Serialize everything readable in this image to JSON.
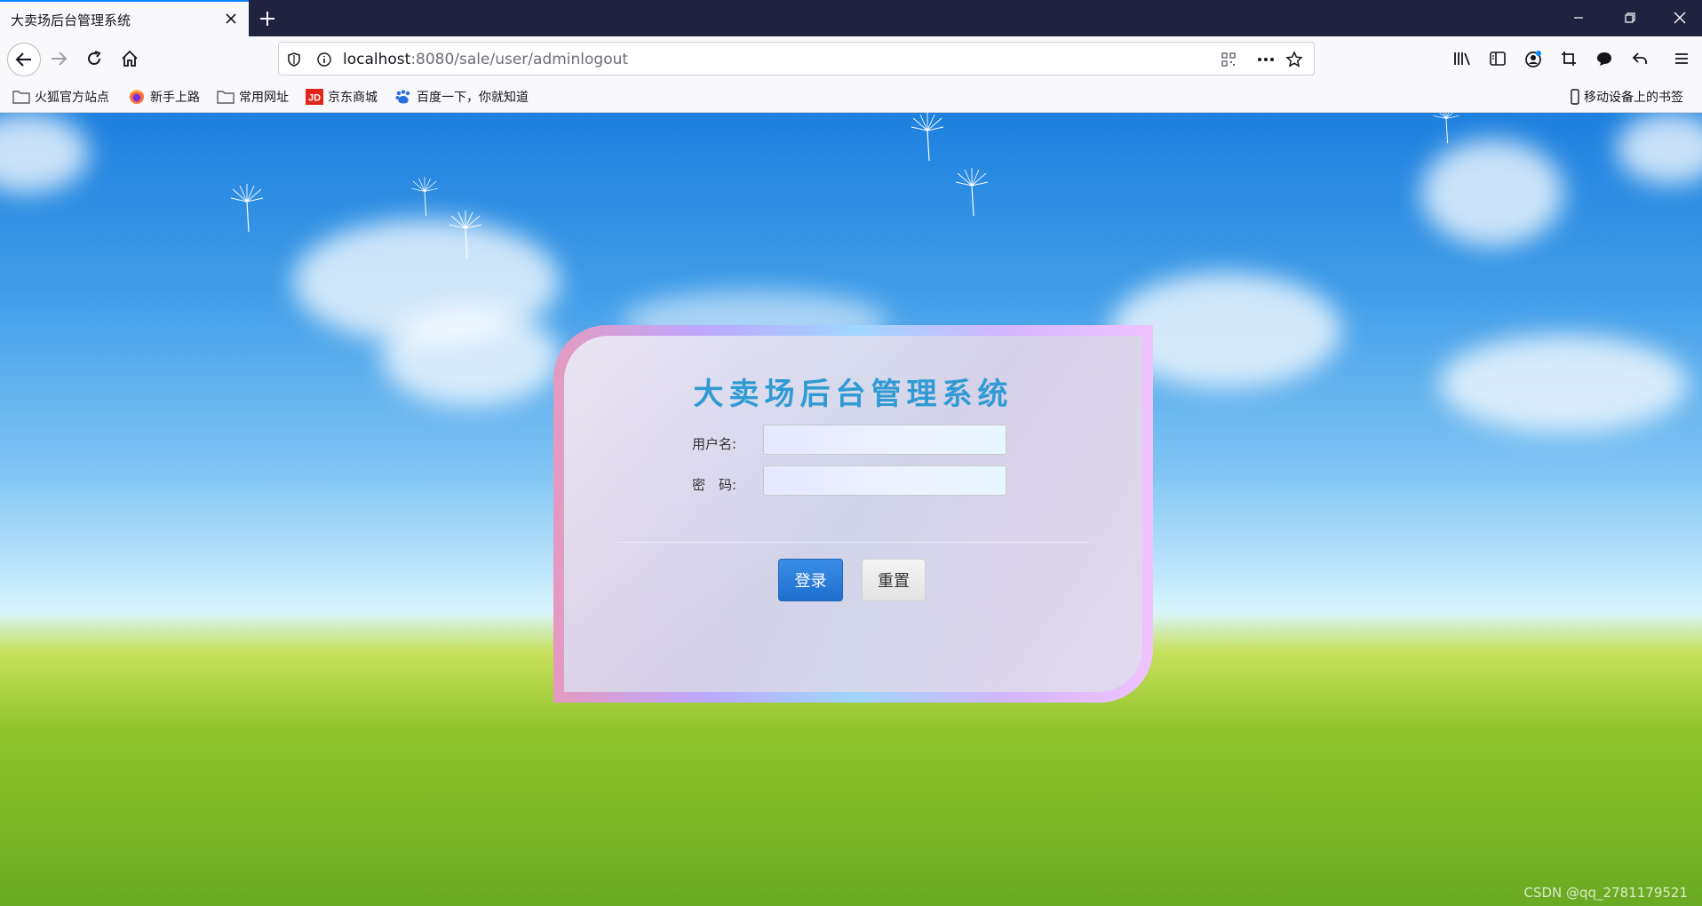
{
  "tab": {
    "title": "大卖场后台管理系统"
  },
  "url": {
    "host": "localhost",
    "path": ":8080/sale/user/adminlogout"
  },
  "bookmarks": [
    {
      "label": "火狐官方站点",
      "icon": "folder-icon"
    },
    {
      "label": "新手上路",
      "icon": "firefox-icon"
    },
    {
      "label": "常用网址",
      "icon": "folder-icon"
    },
    {
      "label": "京东商城",
      "icon": "jd-icon"
    },
    {
      "label": "百度一下，你就知道",
      "icon": "baidu-icon"
    }
  ],
  "mobile_bookmarks": "移动设备上的书签",
  "login": {
    "title": "大卖场后台管理系统",
    "username_label": "用户名:",
    "password_label": "密　码:",
    "username_value": "",
    "password_value": "",
    "login_label": "登录",
    "reset_label": "重置"
  },
  "watermark": "CSDN @qq_2781179521",
  "colors": {
    "accent": "#0a84ff",
    "title_text": "#2f9ad3",
    "login_button": "#2a7fdc"
  }
}
